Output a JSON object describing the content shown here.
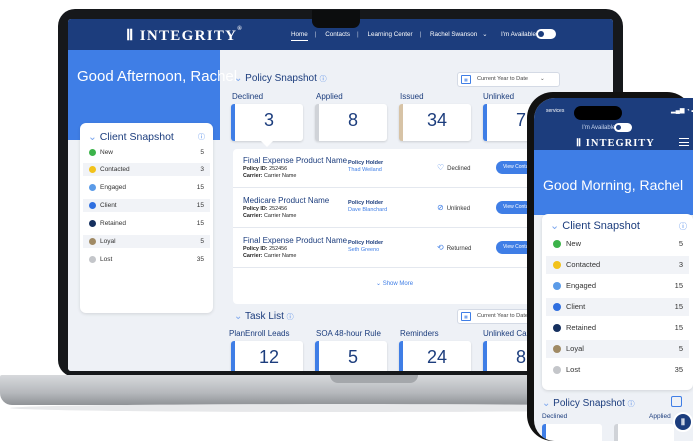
{
  "app": {
    "logo": "INTEGRITY",
    "logo_mark": "®"
  },
  "nav": {
    "items": [
      "Home",
      "Contacts",
      "Learning Center",
      "Rachel Swanson"
    ],
    "available_label": "I'm Available"
  },
  "greeting": "Good Afternoon, Rachel",
  "client_snapshot": {
    "title": "Client Snapshot",
    "rows": [
      {
        "label": "New",
        "count": "5",
        "color": "#3cb34a"
      },
      {
        "label": "Contacted",
        "count": "3",
        "color": "#f2c21b"
      },
      {
        "label": "Engaged",
        "count": "15",
        "color": "#5b9be8"
      },
      {
        "label": "Client",
        "count": "15",
        "color": "#2f6fe0"
      },
      {
        "label": "Retained",
        "count": "15",
        "color": "#16305f"
      },
      {
        "label": "Loyal",
        "count": "5",
        "color": "#a08a64"
      },
      {
        "label": "Lost",
        "count": "35",
        "color": "#c4c6ca"
      }
    ]
  },
  "policy_snapshot": {
    "title": "Policy Snapshot",
    "date_range": "Current Year to Date",
    "stats": [
      {
        "label": "Declined",
        "value": "3"
      },
      {
        "label": "Applied",
        "value": "8"
      },
      {
        "label": "Issued",
        "value": "34"
      },
      {
        "label": "Unlinked",
        "value": "7"
      }
    ],
    "rows": [
      {
        "product": "Final Expense Product Name",
        "policy_label": "Policy ID:",
        "policy_id": "252456",
        "carrier_label": "Carrier:",
        "carrier": "Carrier Name",
        "holder_label": "Policy Holder",
        "holder": "Thad Weiland",
        "status": "Declined",
        "button": "View Contact"
      },
      {
        "product": "Medicare Product Name",
        "policy_label": "Policy ID:",
        "policy_id": "252456",
        "carrier_label": "Carrier:",
        "carrier": "Carrier Name",
        "holder_label": "Policy Holder",
        "holder": "Dave Blanchard",
        "status": "Unlinked",
        "button": "View Contact"
      },
      {
        "product": "Final Expense Product Name",
        "policy_label": "Policy ID:",
        "policy_id": "252456",
        "carrier_label": "Carrier:",
        "carrier": "Carrier Name",
        "holder_label": "Policy Holder",
        "holder": "Seth Greeno",
        "status": "Returned",
        "button": "View Contact"
      }
    ],
    "show_more": "Show More"
  },
  "task_list": {
    "title": "Task List",
    "date_range": "Current Year to Date",
    "stats": [
      {
        "label": "PlanEnroll Leads",
        "value": "12"
      },
      {
        "label": "SOA 48-hour Rule",
        "value": "5"
      },
      {
        "label": "Reminders",
        "value": "24"
      },
      {
        "label": "Unlinked Calls",
        "value": "8"
      }
    ]
  },
  "phone": {
    "time": "services",
    "available_label": "I'm Available",
    "logo": "INTEGRITY",
    "greeting": "Good Morning, Rachel",
    "snapshot_title": "Client Snapshot",
    "policy_title": "Policy Snapshot",
    "declined_label": "Declined",
    "applied_label": "Applied"
  }
}
